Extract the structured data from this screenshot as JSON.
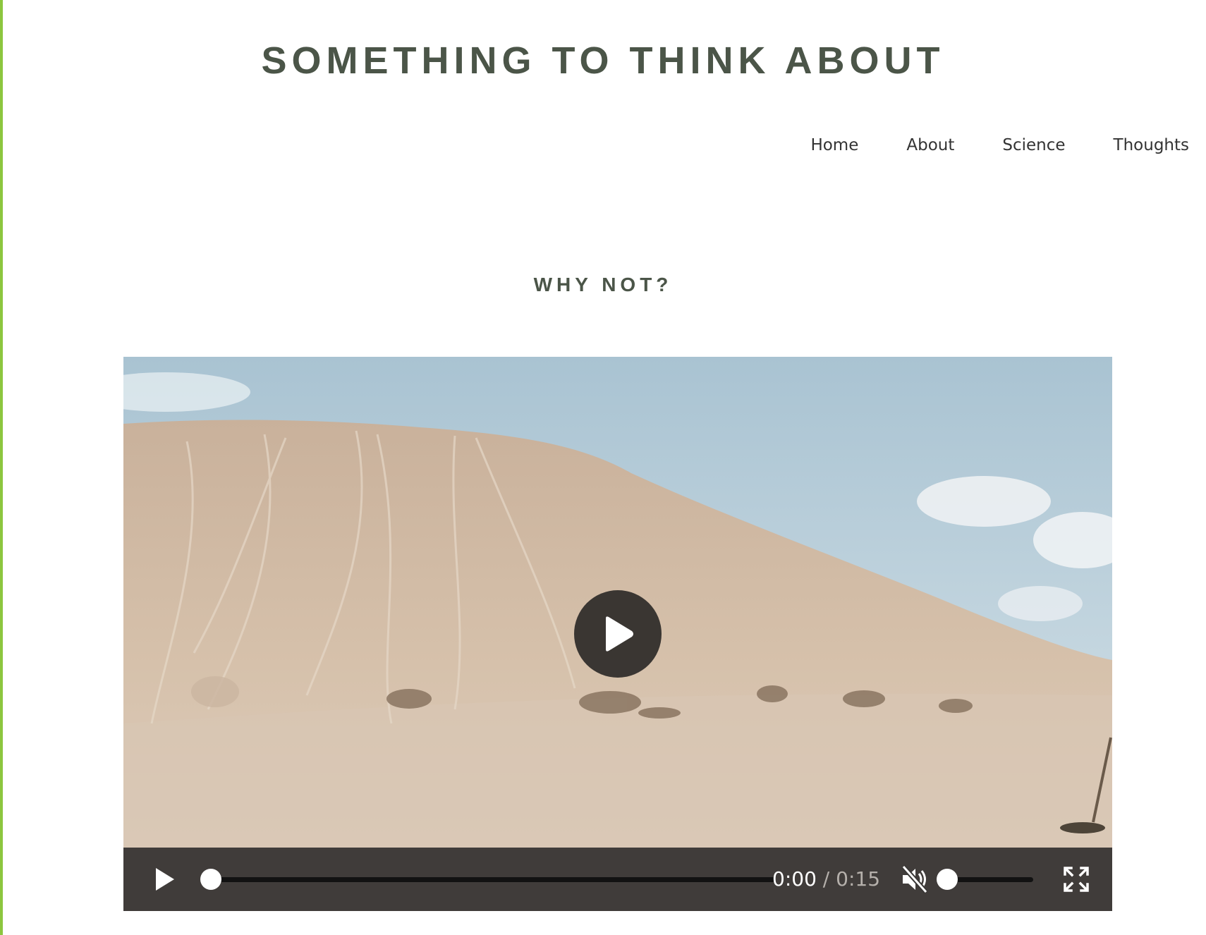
{
  "site": {
    "title": "SOMETHING TO THINK ABOUT",
    "accent_color": "#8cc63f",
    "title_color": "#4b5548"
  },
  "nav": {
    "items": [
      {
        "label": "Home"
      },
      {
        "label": "About"
      },
      {
        "label": "Science"
      },
      {
        "label": "Thoughts"
      }
    ]
  },
  "post": {
    "title": "WHY NOT?"
  },
  "video": {
    "current_time": "0:00",
    "separator": "/",
    "duration": "0:15",
    "progress_fraction": 0,
    "muted": true,
    "volume_fraction": 0,
    "icons": {
      "big_play": "play-icon",
      "control_play": "play-icon",
      "mute": "volume-muted-icon",
      "fullscreen": "fullscreen-icon"
    }
  }
}
